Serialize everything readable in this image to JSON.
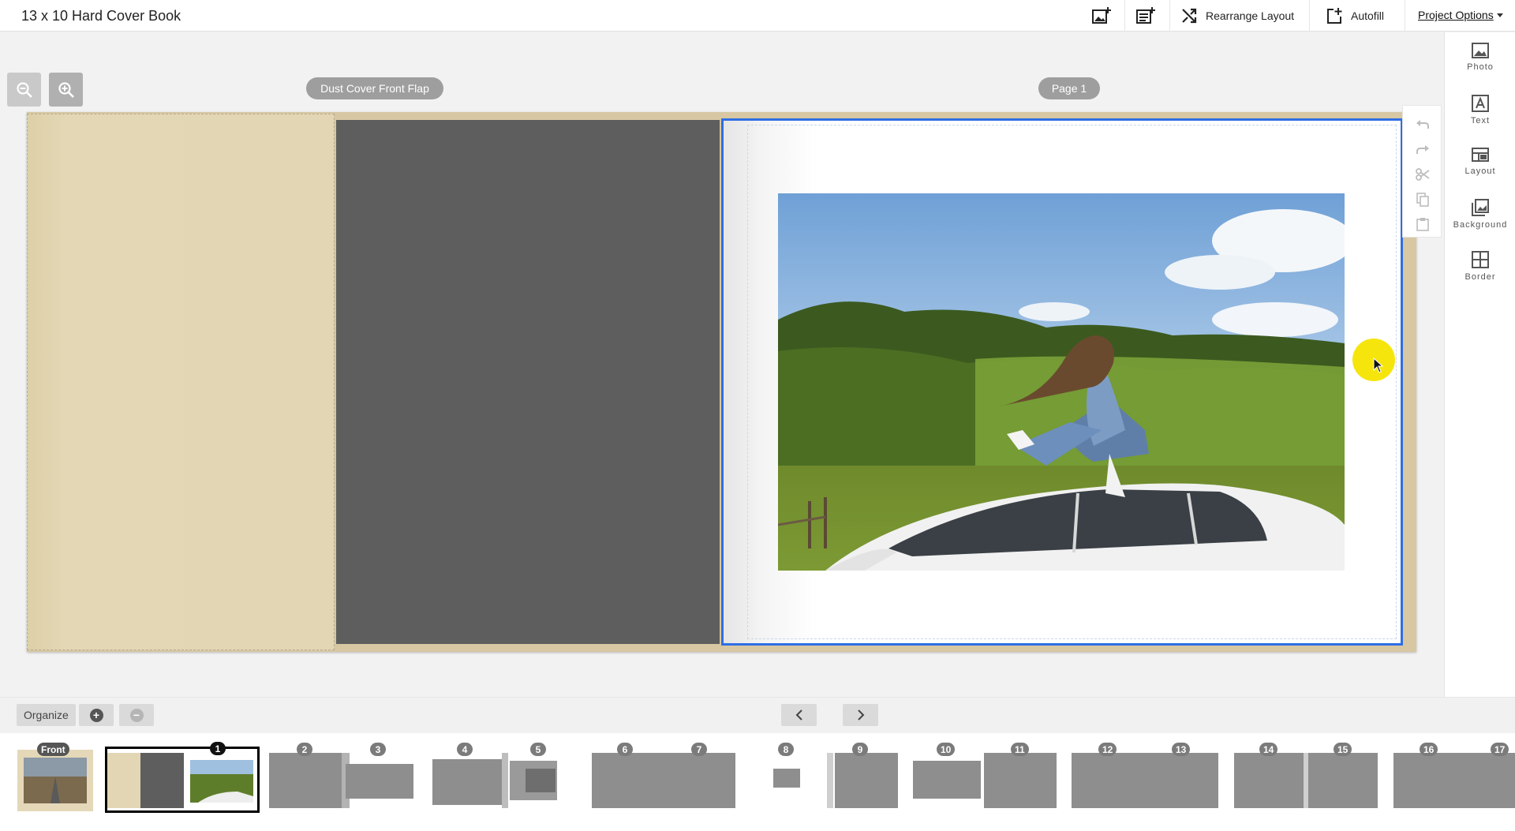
{
  "app": {
    "title": "13 x 10 Hard Cover Book"
  },
  "toolbar": {
    "add_photos_icon": "add-photo-icon",
    "add_page_icon": "add-page-icon",
    "rearrange_label": "Rearrange Layout",
    "autofill_label": "Autofill",
    "project_options_label": "Project Options"
  },
  "canvas": {
    "left_label": "Dust Cover Front Flap",
    "right_label": "Page 1",
    "accent_color": "#2f6ee5"
  },
  "edit_tools": [
    "undo-icon",
    "redo-icon",
    "cut-icon",
    "copy-icon",
    "paste-icon"
  ],
  "right_panel": [
    {
      "label": "Photo",
      "icon": "photo-icon"
    },
    {
      "label": "Text",
      "icon": "text-icon"
    },
    {
      "label": "Layout",
      "icon": "layout-icon"
    },
    {
      "label": "Background",
      "icon": "background-icon"
    },
    {
      "label": "Border",
      "icon": "border-icon"
    }
  ],
  "bottom": {
    "organize_label": "Organize",
    "add_icon": "plus-icon",
    "remove_icon": "minus-icon",
    "prev_icon": "chevron-left-icon",
    "next_icon": "chevron-right-icon"
  },
  "filmstrip": {
    "front_label": "Front",
    "badges": [
      "1",
      "2",
      "3",
      "4",
      "5",
      "6",
      "7",
      "8",
      "9",
      "10",
      "11",
      "12",
      "13",
      "14",
      "15",
      "16",
      "17"
    ]
  }
}
